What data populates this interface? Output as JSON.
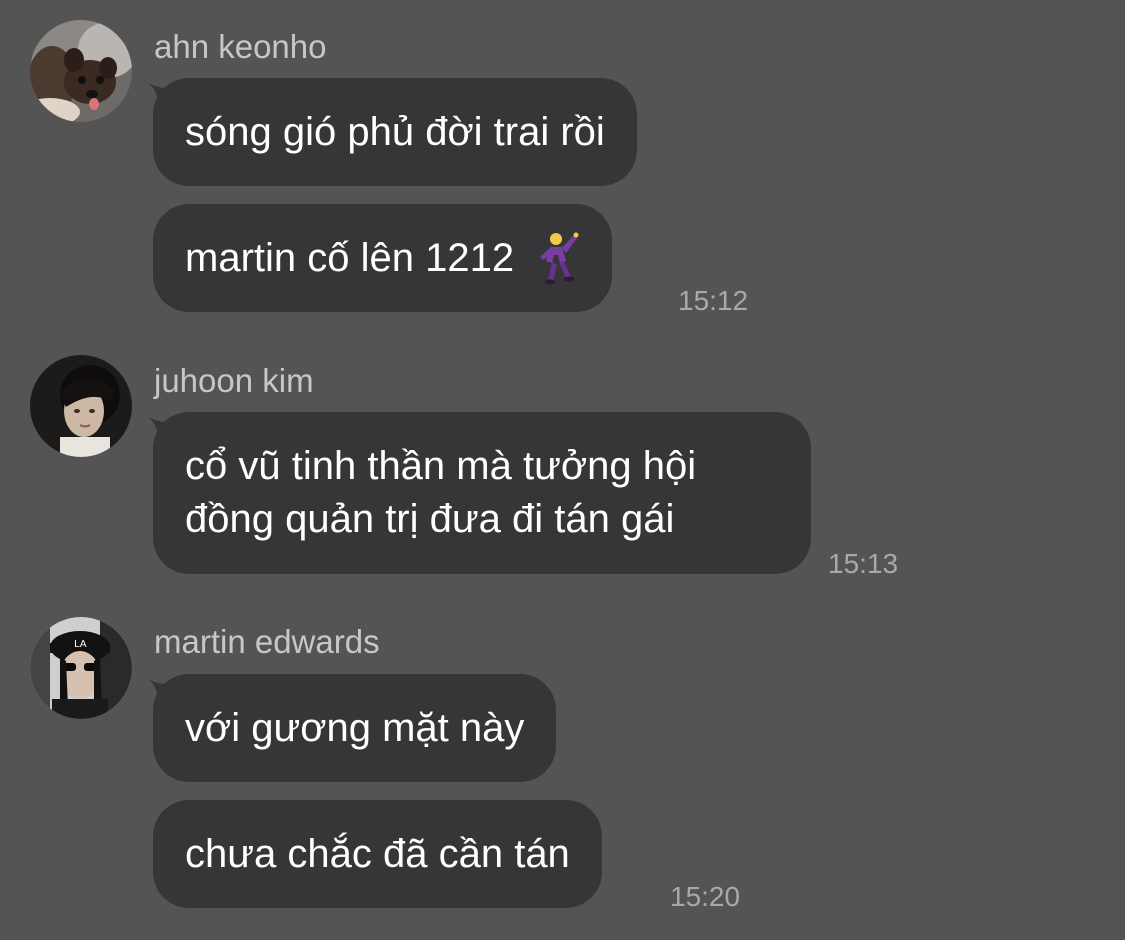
{
  "messages": [
    {
      "sender": "ahn keonho",
      "avatar_icon": "dog-avatar-icon",
      "bubbles": [
        {
          "text": "sóng gió phủ đời trai rồi"
        },
        {
          "text": "martin cố lên 1212",
          "emoji": "man-dancing-purple-suit-emoji"
        }
      ],
      "time": "15:12"
    },
    {
      "sender": "juhoon kim",
      "avatar_icon": "person-portrait-avatar-icon",
      "bubbles": [
        {
          "text": "cổ vũ tinh thần mà tưởng hội đồng quản trị đưa đi tán gái"
        }
      ],
      "time": "15:13"
    },
    {
      "sender": "martin edwards",
      "avatar_icon": "person-cap-avatar-icon",
      "bubbles": [
        {
          "text": "với gương mặt này"
        },
        {
          "text": "chưa chắc đã cần tán"
        }
      ],
      "time": "15:20"
    }
  ],
  "colors": {
    "background": "#555455",
    "bubble": "#363638",
    "sender_text": "#c7c6c9",
    "time_text": "#a9a8ab",
    "message_text": "#ffffff"
  }
}
